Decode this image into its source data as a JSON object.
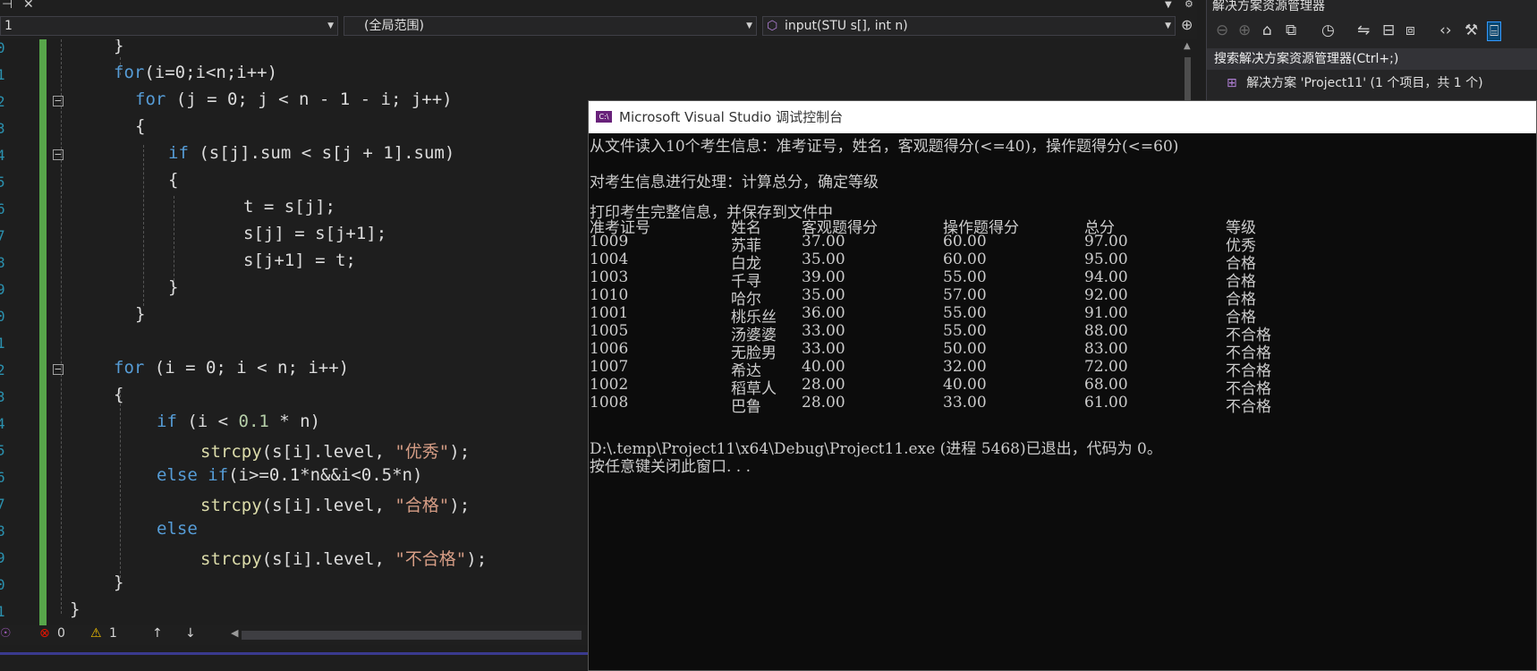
{
  "editor": {
    "nav": {
      "project_combo": "1",
      "scope_combo": "(全局范围)",
      "member_combo": "input(STU s[], int n)"
    },
    "line_numbers": [
      "0",
      "1",
      "2",
      "3",
      "4",
      "5",
      "6",
      "7",
      "8",
      "9",
      "0",
      "1",
      "2",
      "3",
      "4",
      "5",
      "6",
      "7",
      "8",
      "9",
      "0",
      "1"
    ],
    "code": {
      "l1": "}",
      "l2a": "for",
      "l2b": "(i=0;i<n;i++)",
      "l3a": "for",
      "l3b": " (j = 0; j < n - 1 - i; j++)",
      "l4": "{",
      "l5a": "if",
      "l5b": " (s[j].sum < s[j + 1].sum)",
      "l6": "{",
      "l7": "t = s[j];",
      "l8": "s[j] = s[j+1];",
      "l9": "s[j+1] = t;",
      "l10": "}",
      "l11": "}",
      "l13a": "for",
      "l13b": " (i = 0; i < n; i++)",
      "l14": "{",
      "l15a": "if",
      "l15b": " (i < ",
      "l15c": "0.1",
      "l15d": " * n)",
      "l16a": "strcpy",
      "l16b": "(s[i].level, ",
      "l16c": "\"优秀\"",
      "l16d": ");",
      "l17a": "else if",
      "l17b": "(i>=0.1*n&&i<0.5*n)",
      "l18a": "strcpy",
      "l18b": "(s[i].level, ",
      "l18c": "\"合格\"",
      "l18d": ");",
      "l19a": "else",
      "l20a": "strcpy",
      "l20b": "(s[i].level, ",
      "l20c": "\"不合格\"",
      "l20d": ");",
      "l21": "}",
      "l22": "}"
    },
    "status": {
      "errors": "0",
      "warnings": "1"
    }
  },
  "solution_explorer": {
    "title": "解决方案资源管理器",
    "search_placeholder": "搜索解决方案资源管理器(Ctrl+;)",
    "tree_item": "解决方案 'Project11' (1 个项目，共 1 个)"
  },
  "console": {
    "icon_text": "C:\\",
    "title": "Microsoft Visual Studio 调试控制台",
    "lines": {
      "intro1": "从文件读入10个考生信息：准考证号，姓名，客观题得分(<=40)，操作题得分(<=60)",
      "intro2": "对考生信息进行处理：计算总分，确定等级",
      "intro3": "打印考生完整信息，并保存到文件中",
      "exit_msg": "D:\\.temp\\Project11\\x64\\Debug\\Project11.exe (进程 5468)已退出，代码为 0。",
      "press_key": "按任意键关闭此窗口. . ."
    },
    "headers": [
      "准考证号",
      "姓名",
      "客观题得分",
      "操作题得分",
      "总分",
      "等级"
    ],
    "rows": [
      [
        "1009",
        "苏菲",
        "37.00",
        "60.00",
        "97.00",
        "优秀"
      ],
      [
        "1004",
        "白龙",
        "35.00",
        "60.00",
        "95.00",
        "合格"
      ],
      [
        "1003",
        "千寻",
        "39.00",
        "55.00",
        "94.00",
        "合格"
      ],
      [
        "1010",
        "哈尔",
        "35.00",
        "57.00",
        "92.00",
        "合格"
      ],
      [
        "1001",
        "桃乐丝",
        "36.00",
        "55.00",
        "91.00",
        "合格"
      ],
      [
        "1005",
        "汤婆婆",
        "33.00",
        "55.00",
        "88.00",
        "不合格"
      ],
      [
        "1006",
        "无脸男",
        "33.00",
        "50.00",
        "83.00",
        "不合格"
      ],
      [
        "1007",
        "希达",
        "40.00",
        "32.00",
        "72.00",
        "不合格"
      ],
      [
        "1002",
        "稻草人",
        "28.00",
        "40.00",
        "68.00",
        "不合格"
      ],
      [
        "1008",
        "巴鲁",
        "28.00",
        "33.00",
        "61.00",
        "不合格"
      ]
    ]
  }
}
